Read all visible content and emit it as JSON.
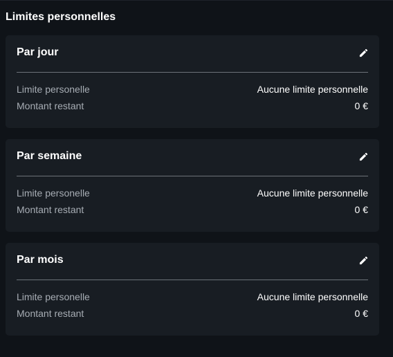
{
  "section": {
    "title": "Limites personnelles"
  },
  "cards": [
    {
      "title": "Par jour",
      "edit_icon": "pencil-icon",
      "rows": [
        {
          "label": "Limite personelle",
          "value": "Aucune limite personnelle"
        },
        {
          "label": "Montant restant",
          "value": "0 €"
        }
      ]
    },
    {
      "title": "Par semaine",
      "edit_icon": "pencil-icon",
      "rows": [
        {
          "label": "Limite personelle",
          "value": "Aucune limite personnelle"
        },
        {
          "label": "Montant restant",
          "value": "0 €"
        }
      ]
    },
    {
      "title": "Par mois",
      "edit_icon": "pencil-icon",
      "rows": [
        {
          "label": "Limite personelle",
          "value": "Aucune limite personnelle"
        },
        {
          "label": "Montant restant",
          "value": "0 €"
        }
      ]
    }
  ],
  "colors": {
    "background": "#0f1318",
    "card": "#181d23",
    "label": "#a7adb4",
    "divider": "#6d737a",
    "text": "#ffffff"
  }
}
